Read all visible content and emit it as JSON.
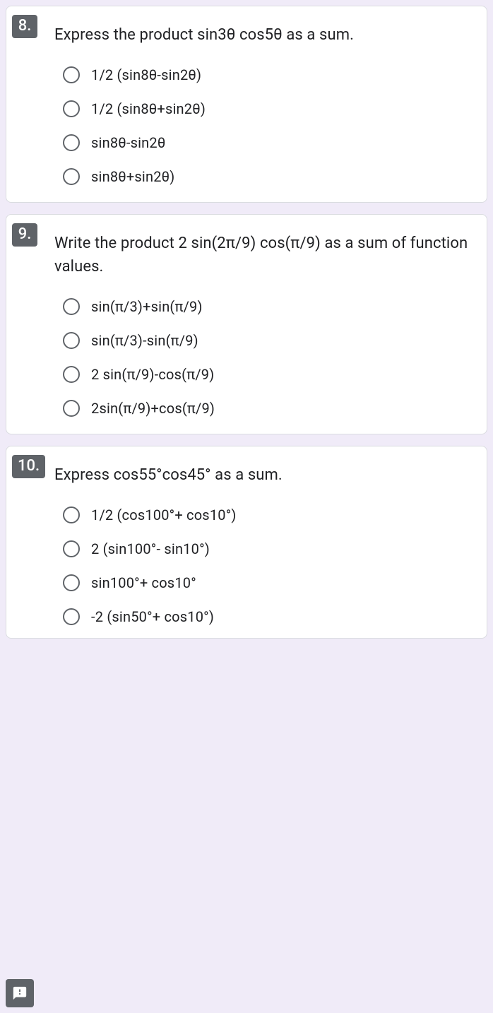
{
  "questions": [
    {
      "number": "8.",
      "text": "Express the product sin3θ cos5θ as a sum.",
      "options": [
        "1/2 (sin8θ-sin2θ)",
        "1/2 (sin8θ+sin2θ)",
        "sin8θ-sin2θ",
        "sin8θ+sin2θ)"
      ]
    },
    {
      "number": "9.",
      "text": "Write the product 2 sin(2π/9) cos(π/9) as a sum of function values.",
      "options": [
        "sin(π/3)+sin(π/9)",
        "sin(π/3)-sin(π/9)",
        "2 sin(π/9)-cos(π/9)",
        "2sin(π/9)+cos(π/9)"
      ]
    },
    {
      "number": "10.",
      "text": "Express cos55°cos45° as a sum.",
      "options": [
        "1/2 (cos100°+ cos10°)",
        "2 (sin100°- sin10°)",
        "sin100°+ cos10°",
        "-2 (sin50°+ cos10°)"
      ]
    }
  ]
}
